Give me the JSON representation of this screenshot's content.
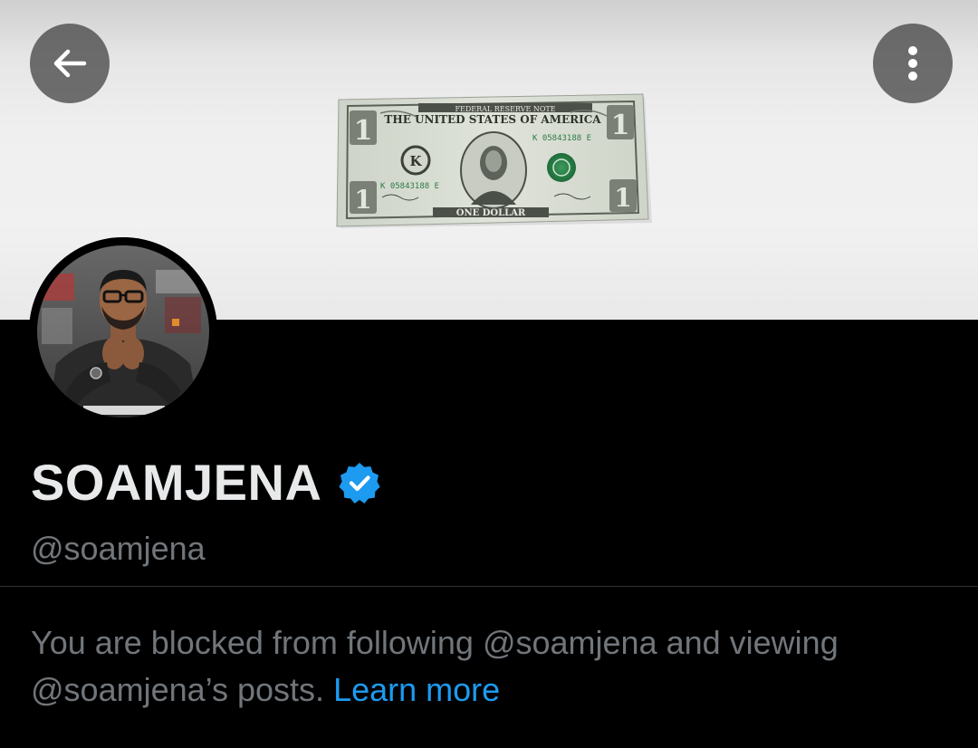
{
  "header": {
    "back_icon": "arrow-left-icon",
    "more_icon": "more-vertical-icon",
    "button_background": "#3c3c3c"
  },
  "banner": {
    "description_icon": "dollar-bill-photo",
    "bill": {
      "top_text": "FEDERAL RESERVE NOTE",
      "country_text": "THE UNITED STATES OF AMERICA",
      "serial": "K 05843188 E",
      "bottom_text": "ONE DOLLAR",
      "denomination": "1",
      "seal_letter": "K"
    }
  },
  "profile": {
    "display_name": "SOAMJENA",
    "verified_icon": "verified-badge-icon",
    "handle": "@soamjena",
    "blocked_text": "You are blocked from following @soamjena and viewing @soamjena’s posts.",
    "learn_more_label": "Learn more"
  },
  "colors": {
    "background": "#000000",
    "name_text": "#e7e9ea",
    "secondary_text": "#71767b",
    "link": "#1d9bf0",
    "verified_badge": "#1d9bf0",
    "divider": "#2f3336"
  }
}
